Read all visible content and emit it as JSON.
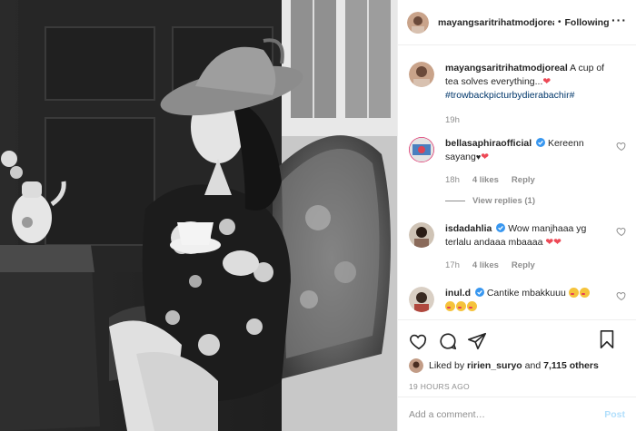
{
  "header": {
    "username": "mayangsaritrihatmodjoreal",
    "separator": "•",
    "follow_state": "Following",
    "more": "..."
  },
  "caption": {
    "username": "mayangsaritrihatmodjoreal",
    "text": "A cup of tea solves everything...",
    "hashtag": "#trowbackpicturbydierabachir#",
    "time": "19h"
  },
  "comments": [
    {
      "username": "bellasaphiraofficial",
      "text": "Kereenn sayang",
      "time": "18h",
      "likes": "4 likes",
      "reply": "Reply",
      "view_replies": "View replies (1)"
    },
    {
      "username": "isdadahlia",
      "text": "Wow manjhaaa yg terlalu andaaa mbaaaa",
      "time": "17h",
      "likes": "4 likes",
      "reply": "Reply"
    },
    {
      "username": "inul.d",
      "text": "Cantike mbakkuuu"
    }
  ],
  "likes": {
    "prefix": "Liked by",
    "user": "ririen_suryo",
    "and": "and",
    "count": "7,115 others"
  },
  "timestamp": "19 HOURS AGO",
  "add_comment": {
    "placeholder": "Add a comment…",
    "post": "Post"
  },
  "colors": {
    "link": "#00376b",
    "verified": "#3897f0",
    "heart": "#ed4956",
    "post_disabled": "#b2dffc",
    "meta": "#8e8e8e"
  },
  "icons": [
    "heart-icon",
    "comment-icon",
    "share-icon",
    "bookmark-icon",
    "verified-icon",
    "more-icon"
  ]
}
